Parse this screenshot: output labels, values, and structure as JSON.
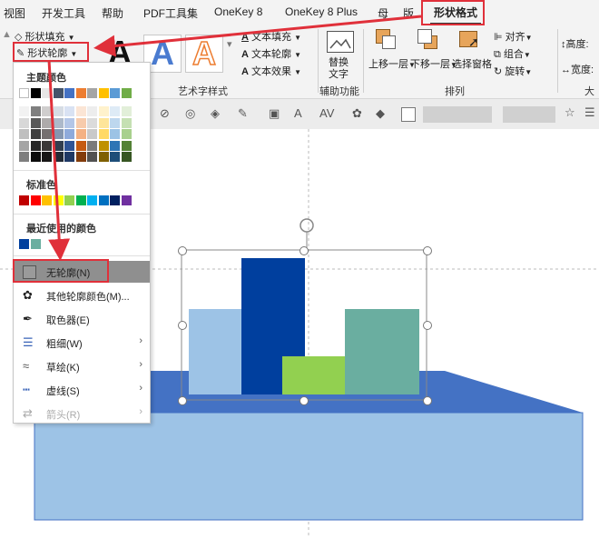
{
  "tabs": [
    "视图",
    "开发工具",
    "帮助",
    "PDF工具集",
    "OneKey 8",
    "OneKey 8 Plus",
    "母",
    "版",
    "形状格式"
  ],
  "ribbon": {
    "shape_fill": "形状填充",
    "shape_outline": "形状轮廓",
    "text_fill": "文本填充",
    "text_outline": "文本轮廓",
    "text_effect": "文本效果",
    "wordart_label": "艺术字样式",
    "wordart_letter": "A",
    "alt_text_1": "替换",
    "alt_text_2": "文字",
    "accessibility_label": "辅助功能",
    "bring_forward": "上移一层",
    "send_backward": "下移一层",
    "selection_pane": "选择窗格",
    "align": "对齐",
    "group": "组合",
    "rotate": "旋转",
    "arrange_label": "排列",
    "height": "高度:",
    "width": "宽度:",
    "size_label": "大"
  },
  "dropdown": {
    "theme_colors": "主题颜色",
    "standard_colors": "标准色",
    "recent_colors": "最近使用的颜色",
    "no_outline": "无轮廓(N)",
    "more_colors": "其他轮廓颜色(M)...",
    "eyedropper": "取色器(E)",
    "weight": "粗细(W)",
    "sketched": "草绘(K)",
    "dashes": "虚线(S)",
    "arrows": "箭头(R)"
  },
  "colors": {
    "theme_row": [
      "#ffffff",
      "#000000",
      "#e7e6e6",
      "#44546a",
      "#4472c4",
      "#ed7d31",
      "#a5a5a5",
      "#ffc000",
      "#5b9bd5",
      "#70ad47"
    ],
    "theme_shades": [
      [
        "#f2f2f2",
        "#7f7f7f",
        "#d0cece",
        "#d6dce4",
        "#d9e2f3",
        "#fbe5d5",
        "#ededed",
        "#fff2cc",
        "#deebf6",
        "#e2efd9"
      ],
      [
        "#d8d8d8",
        "#595959",
        "#aeabab",
        "#adb9ca",
        "#b4c6e7",
        "#f7cbac",
        "#dbdbdb",
        "#fee599",
        "#bdd7ee",
        "#c5e0b3"
      ],
      [
        "#bfbfbf",
        "#3f3f3f",
        "#757070",
        "#8496b0",
        "#8eaadb",
        "#f4b183",
        "#c9c9c9",
        "#ffd965",
        "#9cc3e5",
        "#a8d08d"
      ],
      [
        "#a5a5a5",
        "#262626",
        "#3a3838",
        "#323e4f",
        "#2f5496",
        "#c55a11",
        "#7b7b7b",
        "#bf9000",
        "#2e75b5",
        "#538135"
      ],
      [
        "#7f7f7f",
        "#0c0c0c",
        "#171616",
        "#222a35",
        "#1f3864",
        "#833c0b",
        "#525252",
        "#7f6000",
        "#1e4e79",
        "#375623"
      ]
    ],
    "standard": [
      "#c00000",
      "#ff0000",
      "#ffc000",
      "#ffff00",
      "#92d050",
      "#00b050",
      "#00b0f0",
      "#0070c0",
      "#002060",
      "#7030a0"
    ],
    "recent": [
      "#003f9e",
      "#6aaea0"
    ]
  }
}
